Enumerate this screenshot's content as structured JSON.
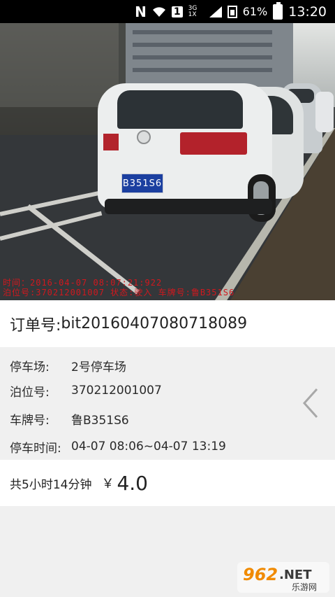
{
  "status_bar": {
    "battery_percent": "61%",
    "time": "13:20",
    "network": "3G 1X",
    "sim_slot": "1",
    "app_indicator": "N"
  },
  "photo": {
    "plate_text": "B351S6",
    "overlay_line1": "时间：2016-04-07  08:07:21:922",
    "overlay_line2": "泊位号:370212001007 状态:驶入  车牌号:鲁B351S6"
  },
  "order": {
    "label": "订单号:",
    "number": "bit20160407080718089"
  },
  "details": [
    {
      "label": "停车场:",
      "value": "2号停车场"
    },
    {
      "label": "泊位号:",
      "value": "370212001007"
    },
    {
      "label": "车牌号:",
      "value": "鲁B351S6"
    },
    {
      "label": "停车时间:",
      "value": "04-07 08:06~04-07 13:19"
    }
  ],
  "total": {
    "duration": "共5小时14分钟",
    "currency": "￥",
    "amount": "4.0"
  },
  "watermark": {
    "text": "962.NET",
    "sub": "乐游网"
  },
  "icons": {
    "back": "chevron-left-icon",
    "wifi": "wifi-icon",
    "signal": "signal-icon",
    "battery": "battery-icon"
  },
  "colors": {
    "overlay_red": "#d1181e",
    "plate_blue": "#1b3fa0",
    "section_gray": "#f0f0f0"
  }
}
